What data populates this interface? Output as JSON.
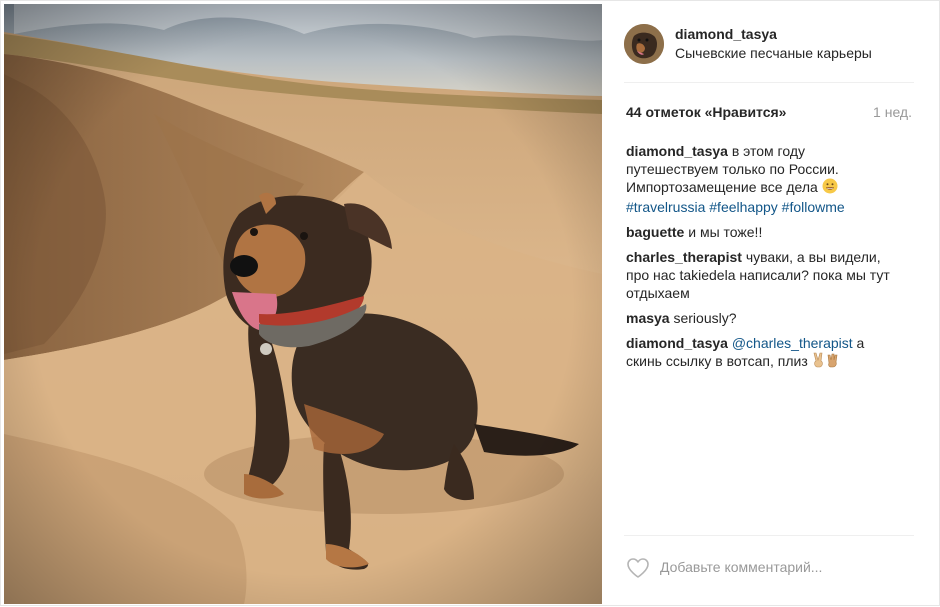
{
  "post": {
    "username": "diamond_tasya",
    "location": "Сычевские песчаные карьеры",
    "likes": "44 отметок «Нравится»",
    "time_ago": "1 нед.",
    "add_comment_placeholder": "Добавьте комментарий..."
  },
  "caption": {
    "user": "diamond_tasya",
    "text": " в этом году путешествуем только по России. Импортозамещение все дела ",
    "emoji": "smiling-face",
    "hashtags": [
      "#travelrussia",
      "#feelhappy",
      "#followme"
    ]
  },
  "comments": [
    {
      "user": "baguette",
      "text": " и мы тоже!!"
    },
    {
      "user": "charles_therapist",
      "text": " чуваки, а вы видели, про нас takiedela написали? пока мы тут отдыхаем"
    },
    {
      "user": "masya",
      "text": " seriously?"
    },
    {
      "user": "diamond_tasya",
      "mention": "@charles_therapist",
      "text": " а скинь ссылку в вотсап, плиз ",
      "emoji": "victory-hand-and-vulcan-salute"
    }
  ],
  "icons": {
    "like": "heart-outline-icon"
  },
  "colors": {
    "text": "#262626",
    "link": "#125688",
    "muted": "#999999",
    "divider": "#efefef"
  }
}
